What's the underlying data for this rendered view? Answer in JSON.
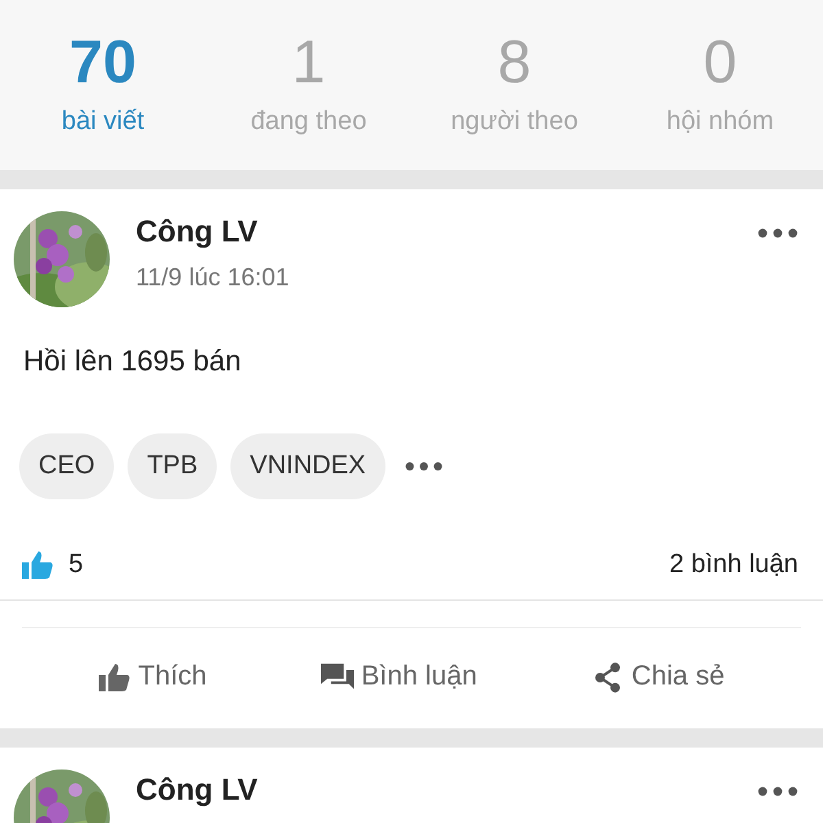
{
  "stats": [
    {
      "value": "70",
      "label": "bài viết",
      "selected": true
    },
    {
      "value": "1",
      "label": "đang theo",
      "selected": false
    },
    {
      "value": "8",
      "label": "người theo",
      "selected": false
    },
    {
      "value": "0",
      "label": "hội nhóm",
      "selected": false
    }
  ],
  "posts": [
    {
      "author": "Công LV",
      "time": "11/9 lúc 16:01",
      "text": "Hồi lên 1695 bán",
      "tags": [
        "CEO",
        "TPB",
        "VNINDEX"
      ],
      "likes": "5",
      "comments": "2 bình luận",
      "actions": [
        {
          "kind": "like",
          "label": "Thích"
        },
        {
          "kind": "comment",
          "label": "Bình luận"
        },
        {
          "kind": "share",
          "label": "Chia sẻ"
        }
      ]
    },
    {
      "author": "Công LV"
    }
  ]
}
